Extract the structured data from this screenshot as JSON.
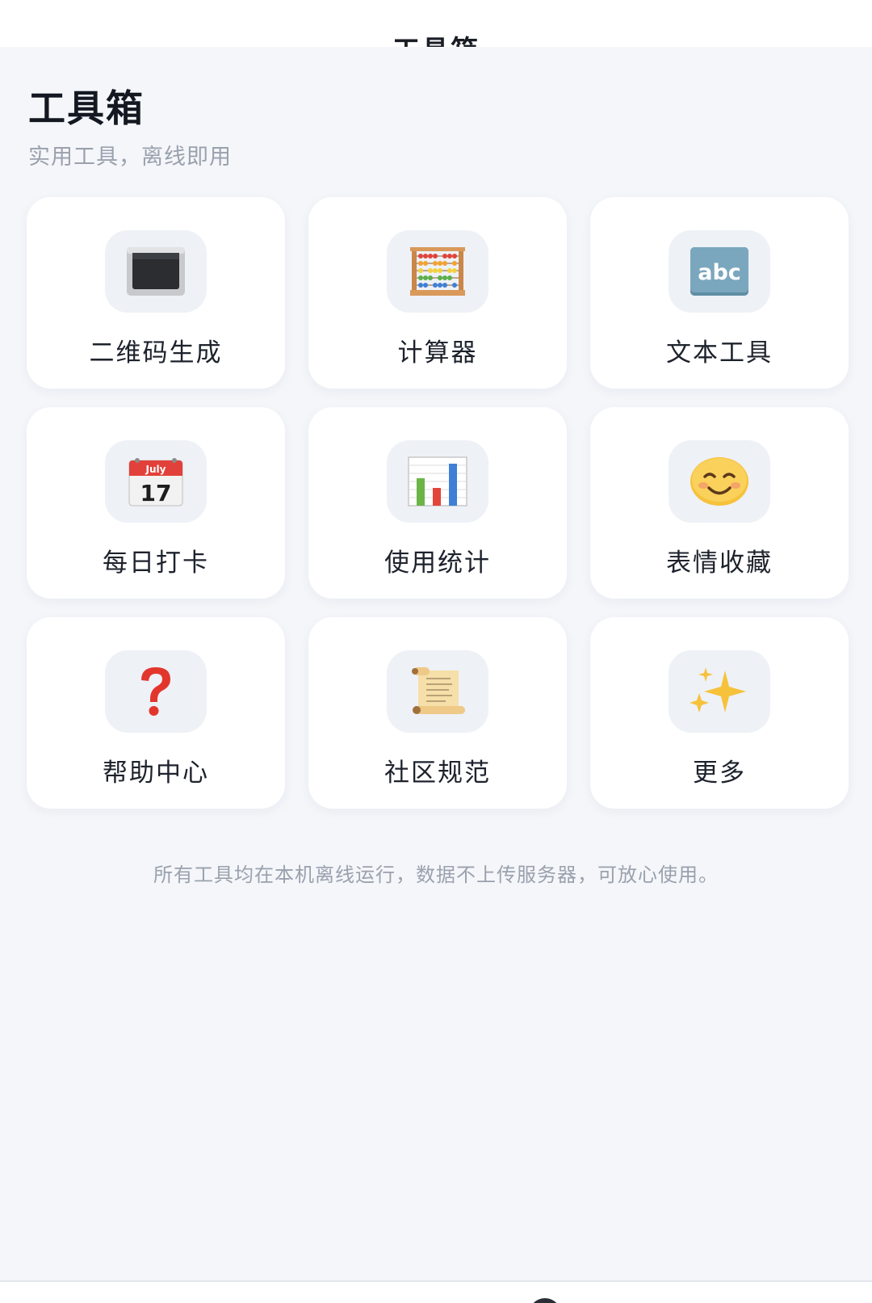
{
  "topbar": {
    "title": "工具箱"
  },
  "header": {
    "title": "工具箱",
    "subtitle": "实用工具，离线即用"
  },
  "tools": [
    {
      "label": "二维码生成",
      "icon": "terminal-screen-icon"
    },
    {
      "label": "计算器",
      "icon": "abacus-icon"
    },
    {
      "label": "文本工具",
      "icon": "abc-text-icon"
    },
    {
      "label": "每日打卡",
      "icon": "calendar-icon",
      "icon_text": {
        "month": "July",
        "day": "17"
      }
    },
    {
      "label": "使用统计",
      "icon": "bar-chart-icon"
    },
    {
      "label": "表情收藏",
      "icon": "smiley-icon"
    },
    {
      "label": "帮助中心",
      "icon": "question-mark-icon"
    },
    {
      "label": "社区规范",
      "icon": "scroll-icon"
    },
    {
      "label": "更多",
      "icon": "sparkles-icon"
    }
  ],
  "footer": {
    "note": "所有工具均在本机离线运行，数据不上传服务器，可放心使用。"
  },
  "colors": {
    "background": "#f4f6fa",
    "tile": "#ffffff",
    "icon_bg": "#eef1f6",
    "muted_text": "#9aa1ad"
  }
}
